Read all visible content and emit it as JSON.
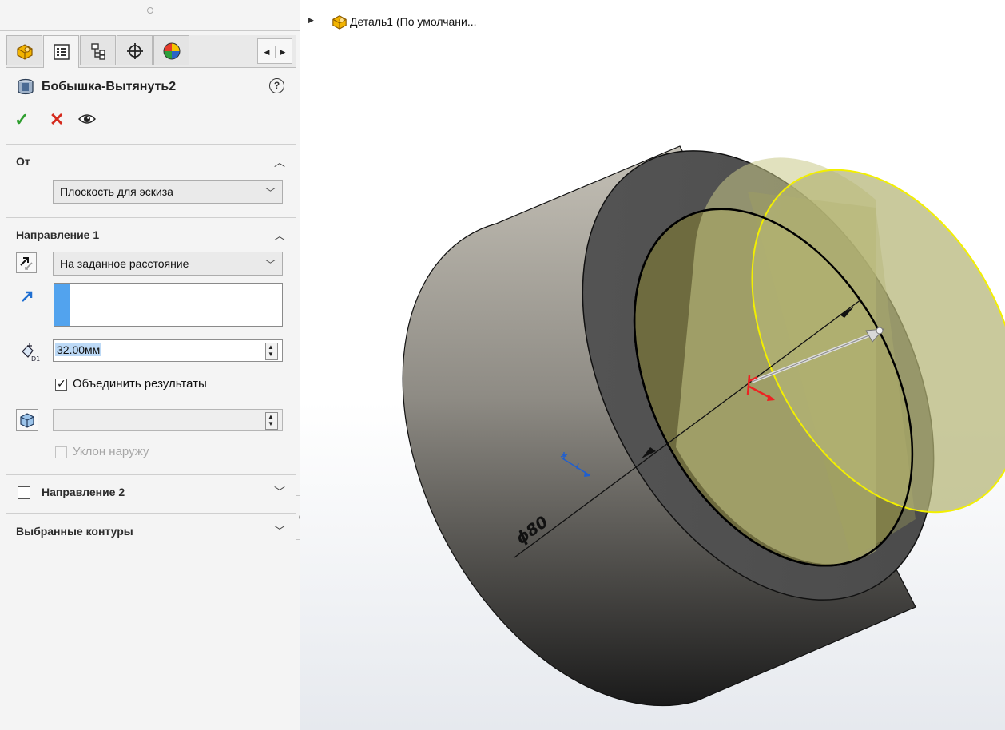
{
  "tree": {
    "label": "Деталь1  (По умолчани..."
  },
  "feature": {
    "title": "Бобышка-Вытянуть2",
    "help": "?"
  },
  "actions": {
    "ok": "✓",
    "cancel": "✕"
  },
  "tabs": [
    {
      "icon": "part-icon",
      "active": false
    },
    {
      "icon": "property-manager-icon",
      "active": true
    },
    {
      "icon": "configuration-manager-icon",
      "active": false
    },
    {
      "icon": "dimxpert-icon",
      "active": false
    },
    {
      "icon": "display-manager-icon",
      "active": false
    }
  ],
  "from": {
    "header": "От",
    "value": "Плоскость для эскиза"
  },
  "direction1": {
    "header": "Направление 1",
    "end_condition": "На заданное расстояние",
    "depth": "32.00мм",
    "merge_label": "Объединить результаты",
    "merge_checked": true,
    "draft_label": "Уклон наружу",
    "draft_checked": false
  },
  "direction2": {
    "header": "Направление 2",
    "checked": false
  },
  "contours": {
    "header": "Выбранные контуры"
  },
  "model": {
    "dimension": "ϕ80"
  },
  "colors": {
    "accent": "#52a3ee",
    "ok": "#2e9e2e",
    "cancel": "#d52b1e",
    "preview": "#ffff00"
  }
}
